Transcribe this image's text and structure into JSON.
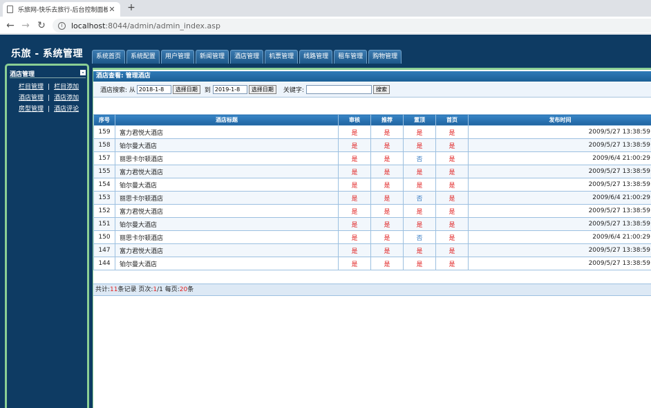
{
  "browser": {
    "tab_title": "乐旅网-快乐去旅行-后台控制面板",
    "new_tab": "+",
    "url_host": "localhost",
    "url_path": ":8044/admin/admin_index.asp"
  },
  "header": {
    "logo": "乐旅 - 系统管理",
    "nav": [
      "系统首页",
      "系统配置",
      "用户管理",
      "新闻管理",
      "酒店管理",
      "机票管理",
      "线路管理",
      "租车管理",
      "购物管理"
    ]
  },
  "sidebar": {
    "title": "酒店管理",
    "collapse": "-",
    "rows": [
      [
        "栏目管理",
        "栏目添加"
      ],
      [
        "酒店管理",
        "酒店添加"
      ],
      [
        "房型管理",
        "酒店评论"
      ]
    ],
    "sep": "|"
  },
  "main": {
    "breadcrumb": "酒店查看: 管理酒店",
    "search": {
      "label_from": "酒店搜索: 从",
      "from_value": "2018-1-8",
      "pick_date": "选择日期",
      "label_to": "到",
      "to_value": "2019-1-8",
      "label_keyword": "关键字:",
      "keyword_value": "",
      "search_button": "搜索"
    },
    "columns": [
      "序号",
      "酒店标题",
      "审核",
      "推荐",
      "置顶",
      "首页",
      "发布时间"
    ],
    "rows": [
      [
        "159",
        "富力君悦大酒店",
        "是",
        "是",
        "是",
        "是",
        "2009/5/27 13:38:59"
      ],
      [
        "158",
        "铂尔曼大酒店",
        "是",
        "是",
        "是",
        "是",
        "2009/5/27 13:38:59"
      ],
      [
        "157",
        "丽思卡尔顿酒店",
        "是",
        "是",
        "否",
        "是",
        "2009/6/4 21:00:29"
      ],
      [
        "155",
        "富力君悦大酒店",
        "是",
        "是",
        "是",
        "是",
        "2009/5/27 13:38:59"
      ],
      [
        "154",
        "铂尔曼大酒店",
        "是",
        "是",
        "是",
        "是",
        "2009/5/27 13:38:59"
      ],
      [
        "153",
        "丽思卡尔顿酒店",
        "是",
        "是",
        "否",
        "是",
        "2009/6/4 21:00:29"
      ],
      [
        "152",
        "富力君悦大酒店",
        "是",
        "是",
        "是",
        "是",
        "2009/5/27 13:38:59"
      ],
      [
        "151",
        "铂尔曼大酒店",
        "是",
        "是",
        "是",
        "是",
        "2009/5/27 13:38:59"
      ],
      [
        "150",
        "丽思卡尔顿酒店",
        "是",
        "是",
        "否",
        "是",
        "2009/6/4 21:00:29"
      ],
      [
        "147",
        "富力君悦大酒店",
        "是",
        "是",
        "是",
        "是",
        "2009/5/27 13:38:59"
      ],
      [
        "144",
        "铂尔曼大酒店",
        "是",
        "是",
        "是",
        "是",
        "2009/5/27 13:38:59"
      ]
    ],
    "footer": {
      "total_label": "共计:",
      "total": "11",
      "records_label": "条记录 页次:",
      "page": "1",
      "page_total": "/1 每页:",
      "per_page": "20",
      "per_page_unit": "条"
    }
  },
  "colors": {
    "header_bg": "#0e3b63",
    "border_green": "#8bcf94",
    "yes": "#e02020",
    "no": "#3a7dc4"
  }
}
